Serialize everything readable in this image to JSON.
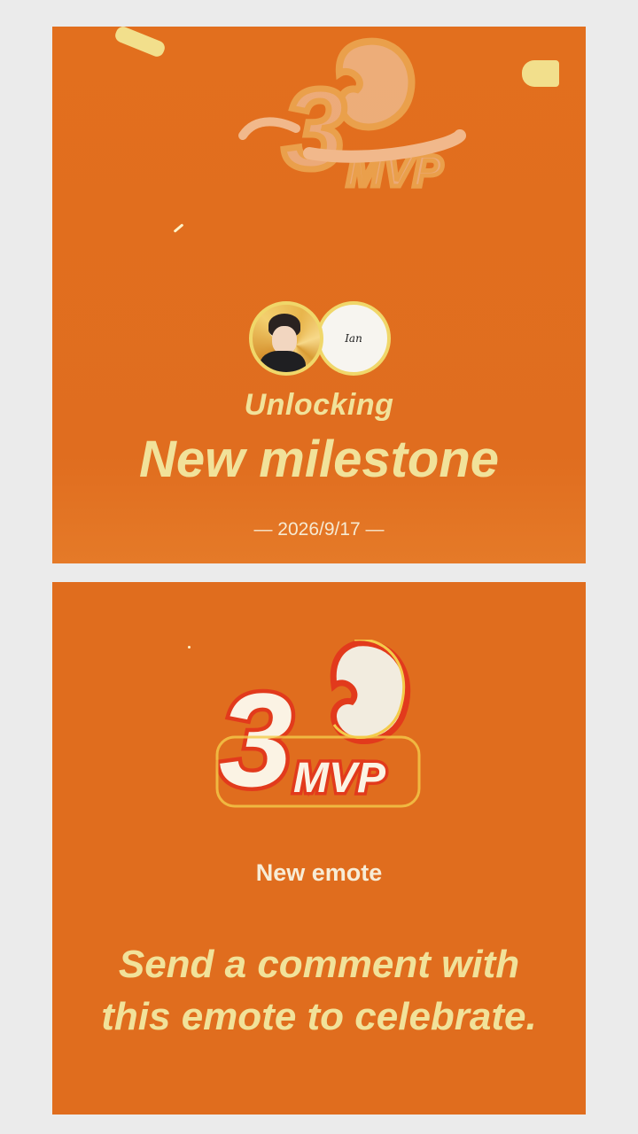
{
  "milestone_card": {
    "emote_icon": "3-mvp-emote",
    "avatars": [
      {
        "name": "user-photo"
      },
      {
        "name": "Ian"
      }
    ],
    "heading": "Unlocking",
    "title": "New milestone",
    "date": "— 2026/9/17 —"
  },
  "emote_card": {
    "emote_icon": "3-mvp-emote",
    "label": "New emote",
    "message": "Send a comment with this emote to celebrate."
  },
  "colors": {
    "background": "#ebebeb",
    "card": "#e06e1f",
    "accent_yellow": "#f1e29a",
    "emote_red": "#e23a1c"
  }
}
